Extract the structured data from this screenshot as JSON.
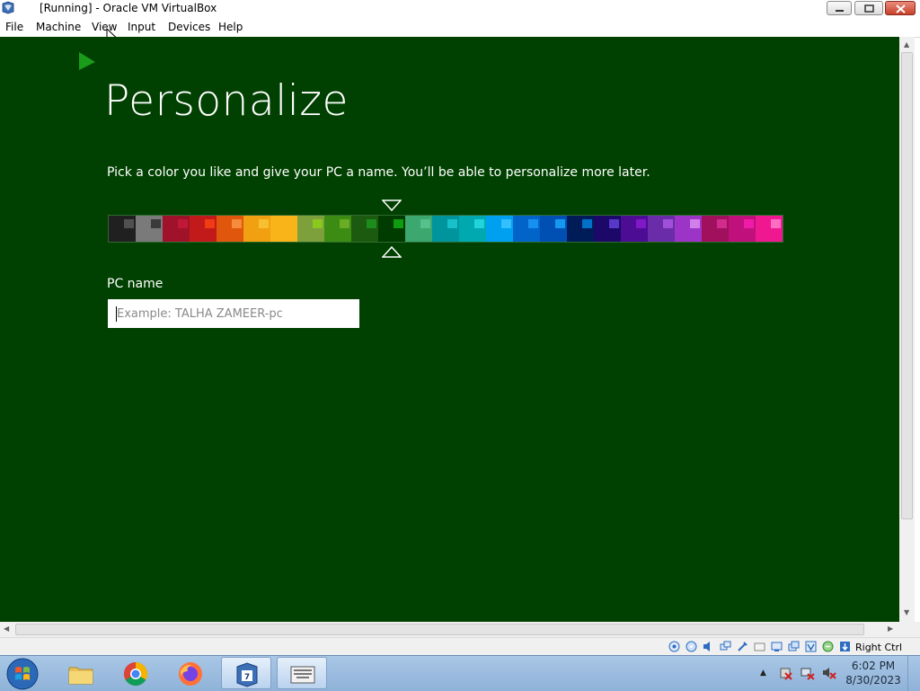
{
  "window": {
    "title": "[Running] - Oracle VM VirtualBox",
    "app_icon": "virtualbox-icon",
    "controls": [
      "minimize-icon",
      "restore-icon",
      "close-icon"
    ]
  },
  "menu": {
    "items": [
      "File",
      "Machine",
      "View",
      "Input",
      "Devices",
      "Help"
    ]
  },
  "setup": {
    "heading": "Personalize",
    "subtitle": "Pick a color you like and give your PC a name. You’ll be able to personalize more later.",
    "selected_swatch_index": 10,
    "swatches": [
      {
        "bg": "#202020",
        "chip": "#505050"
      },
      {
        "bg": "#7a7a7a",
        "chip": "#3a3a3a"
      },
      {
        "bg": "#a0122a",
        "chip": "#c01838"
      },
      {
        "bg": "#c21a1a",
        "chip": "#f03c14"
      },
      {
        "bg": "#e0560c",
        "chip": "#f58b3c"
      },
      {
        "bg": "#f0a010",
        "chip": "#f8c030"
      },
      {
        "bg": "#f8b418",
        "chip": "#f8b418"
      },
      {
        "bg": "#7ea03c",
        "chip": "#8ac820"
      },
      {
        "bg": "#3c8c14",
        "chip": "#6aac24"
      },
      {
        "bg": "#1c5a10",
        "chip": "#1c8c1c"
      },
      {
        "bg": "#003c00",
        "chip": "#109c10"
      },
      {
        "bg": "#3ca870",
        "chip": "#58c08c"
      },
      {
        "bg": "#00949c",
        "chip": "#18c0cc"
      },
      {
        "bg": "#00a8b0",
        "chip": "#20d4dc"
      },
      {
        "bg": "#00a0f0",
        "chip": "#34c0ff"
      },
      {
        "bg": "#0064c8",
        "chip": "#1890f0"
      },
      {
        "bg": "#0050b4",
        "chip": "#1498f0"
      },
      {
        "bg": "#001c58",
        "chip": "#0070c8"
      },
      {
        "bg": "#1c0868",
        "chip": "#5838c8"
      },
      {
        "bg": "#4c0c94",
        "chip": "#8018c8"
      },
      {
        "bg": "#6a2ca8",
        "chip": "#a050d8"
      },
      {
        "bg": "#9c34c8",
        "chip": "#d080e8"
      },
      {
        "bg": "#a0105c",
        "chip": "#d02c8c"
      },
      {
        "bg": "#c0107c",
        "chip": "#f01ca8"
      },
      {
        "bg": "#f01890",
        "chip": "#ff6cc4"
      }
    ],
    "pc_name_label": "PC name",
    "pc_name_placeholder": "Example: TALHA ZAMEER-pc",
    "pc_name_value": ""
  },
  "statusbar": {
    "host_key": "Right Ctrl",
    "icons": [
      "hard-disk-icon",
      "optical-drive-icon",
      "audio-icon",
      "network-icon",
      "usb-icon",
      "shared-folders-icon",
      "display-icon",
      "video-capture-icon",
      "vt-x-icon",
      "mouse-integration-icon",
      "keyboard-capture-icon"
    ]
  },
  "taskbar": {
    "items": [
      {
        "name": "start-button",
        "icon": "windows-orb-icon"
      },
      {
        "name": "file-explorer",
        "icon": "folder-icon"
      },
      {
        "name": "chrome",
        "icon": "chrome-icon"
      },
      {
        "name": "firefox",
        "icon": "firefox-icon"
      },
      {
        "name": "virtualbox",
        "icon": "virtualbox-icon",
        "active": true
      },
      {
        "name": "on-screen-keyboard",
        "icon": "keyboard-icon",
        "active": true
      }
    ],
    "tray": [
      "show-hidden-icons",
      "action-center-icon",
      "network-icon",
      "volume-muted-icon"
    ],
    "time": "6:02 PM",
    "date": "8/30/2023"
  }
}
